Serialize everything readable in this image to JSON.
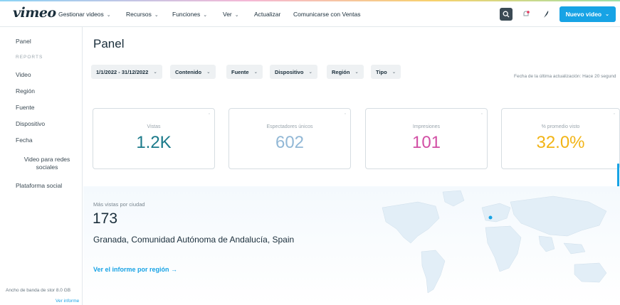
{
  "colors": {
    "accent_blue": "#17a3e5",
    "views": "#1b7a8a",
    "unique_viewers": "#92b8d6",
    "impressions": "#d24fa5",
    "avg_watched": "#f2b416"
  },
  "brand": {
    "logo": "vimeo"
  },
  "nav": {
    "items": [
      {
        "label": "Gestionar videos",
        "chevron": true
      },
      {
        "label": "Recursos",
        "chevron": true
      },
      {
        "label": "Funciones",
        "chevron": true
      },
      {
        "label": "Ver",
        "chevron": true
      },
      {
        "label": "Actualizar",
        "chevron": false
      },
      {
        "label": "Comunicarse con Ventas",
        "chevron": false
      }
    ],
    "new_video_label": "Nuevo video",
    "chevron": "⌄"
  },
  "sidebar": {
    "panel": "Panel",
    "section_label": "REPORTS",
    "items": [
      "Video",
      "Región",
      "Fuente",
      "Dispositivo",
      "Fecha"
    ],
    "social_video": "Video para redes sociales",
    "social_platform": "Plataforma social",
    "bandwidth": "Ancho de banda de stor  8.0 GB",
    "view_report": "Ver informe"
  },
  "main": {
    "title": "Panel",
    "filters": [
      {
        "label": "1/1/2022 - 31/12/2022"
      },
      {
        "label": "Contenido"
      },
      {
        "label": "Fuente"
      },
      {
        "label": "Dispositivo"
      },
      {
        "label": "Región"
      },
      {
        "label": "Tipo"
      }
    ],
    "last_update": "Fecha de la última actualización: Hace 20 segund",
    "cards": [
      {
        "label": "Vistas",
        "value": "1.2K"
      },
      {
        "label": "Espectadores únicos",
        "value": "602"
      },
      {
        "label": "Impresiones",
        "value": "101"
      },
      {
        "label": "% promedio visto",
        "value": "32.0%"
      }
    ],
    "top_city": {
      "label": "Más vistas por ciudad",
      "count": "173",
      "name": "Granada, Comunidad Autónoma de Andalucía, Spain",
      "link": "Ver el informe por región →"
    }
  }
}
